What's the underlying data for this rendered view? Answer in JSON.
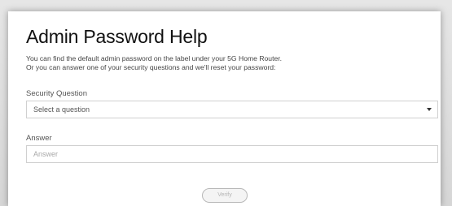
{
  "header": {
    "title": "Admin Password Help"
  },
  "description": {
    "line1": "You can find the default admin password on the label under your 5G Home Router.",
    "line2": "Or you can answer one of your security questions and we'll reset your password:"
  },
  "security_question": {
    "label": "Security Question",
    "selected_value": "Select a question",
    "icon": "caret-down-icon"
  },
  "answer": {
    "label": "Answer",
    "value": "",
    "placeholder": "Answer"
  },
  "actions": {
    "verify_label": "Verify",
    "verify_enabled": false
  }
}
